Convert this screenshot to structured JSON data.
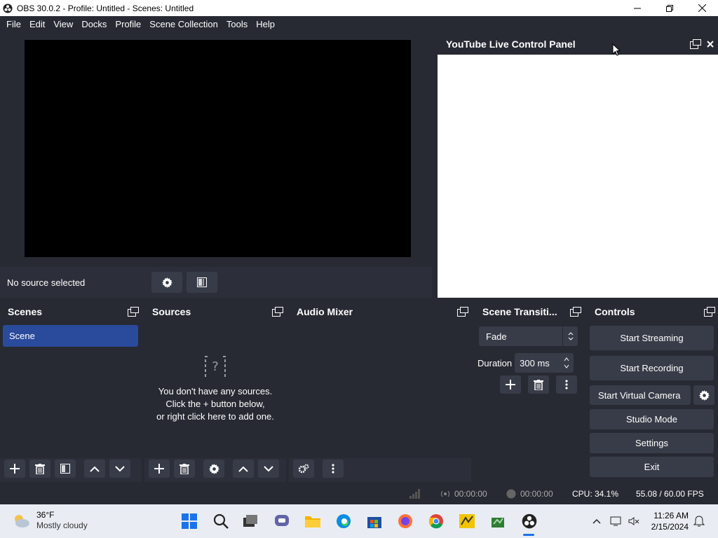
{
  "window": {
    "title": "OBS 30.0.2 - Profile: Untitled - Scenes: Untitled"
  },
  "menu": [
    "File",
    "Edit",
    "View",
    "Docks",
    "Profile",
    "Scene Collection",
    "Tools",
    "Help"
  ],
  "source_toolbar": {
    "label": "No source selected"
  },
  "youtube_dock": {
    "title": "YouTube Live Control Panel"
  },
  "scenes": {
    "title": "Scenes",
    "items": [
      "Scene"
    ]
  },
  "sources": {
    "title": "Sources",
    "empty_line1": "You don't have any sources.",
    "empty_line2": "Click the + button below,",
    "empty_line3": "or right click here to add one."
  },
  "mixer": {
    "title": "Audio Mixer"
  },
  "transitions": {
    "title": "Scene Transiti...",
    "selected": "Fade",
    "duration_label": "Duration",
    "duration_value": "300 ms"
  },
  "controls": {
    "title": "Controls",
    "start_streaming": "Start Streaming",
    "start_recording": "Start Recording",
    "start_virtual_camera": "Start Virtual Camera",
    "studio_mode": "Studio Mode",
    "settings": "Settings",
    "exit": "Exit"
  },
  "status": {
    "stream_time": "00:00:00",
    "record_time": "00:00:00",
    "cpu": "CPU: 34.1%",
    "fps": "55.08 / 60.00 FPS"
  },
  "taskbar": {
    "weather_temp": "36°F",
    "weather_cond": "Mostly cloudy",
    "time": "11:26 AM",
    "date": "2/15/2024"
  }
}
